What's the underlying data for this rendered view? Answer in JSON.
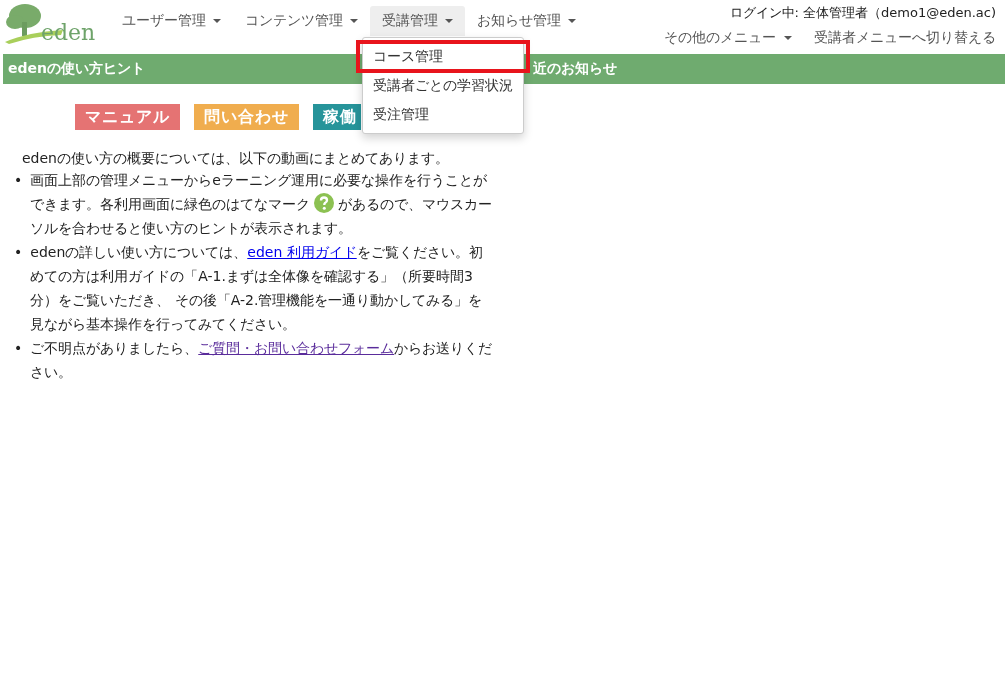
{
  "logo": {
    "text": "eden"
  },
  "nav": [
    {
      "label": "ユーザー管理",
      "selected": false
    },
    {
      "label": "コンテンツ管理",
      "selected": false
    },
    {
      "label": "受講管理",
      "selected": true
    },
    {
      "label": "お知らせ管理",
      "selected": false
    }
  ],
  "dropdown": [
    {
      "label": "コース管理",
      "highlighted": true
    },
    {
      "label": "受講者ごとの学習状況",
      "highlighted": false
    },
    {
      "label": "受注管理",
      "highlighted": false
    }
  ],
  "login": "ログイン中: 全体管理者（demo1@eden.ac)",
  "other_menu": "その他のメニュー",
  "switch_link": "受講者メニューへ切り替える",
  "hint_panel": {
    "title": "edenの使い方ヒント",
    "buttons": [
      {
        "label": "マニュアル",
        "color": "#e57373"
      },
      {
        "label": "問い合わせ",
        "color": "#f0ad4e"
      },
      {
        "label": "稼働",
        "color": "#26949a"
      }
    ],
    "intro": "edenの使い方の概要については、以下の動画にまとめてあります。",
    "bullets": [
      {
        "marker": "•",
        "segments": [
          {
            "kind": "text",
            "text": "画面上部の管理メニューからeラーニング運用に必要な操作を行うことができます。各利用画面に緑色のはてなマーク"
          },
          {
            "kind": "help"
          },
          {
            "kind": "text",
            "text": "があるので、マウスカーソルを合わせると使い方のヒントが表示されます。"
          }
        ]
      },
      {
        "marker": "•",
        "segments": [
          {
            "kind": "text",
            "text": "edenの詳しい使い方については、"
          },
          {
            "kind": "link",
            "text": "eden 利用ガイド",
            "visited": false
          },
          {
            "kind": "text",
            "text": "をご覧ください。初めての方は利用ガイドの「A-1.まずは全体像を確認する」（所要時間3分）をご覧いただき、 その後「A-2.管理機能を一通り動かしてみる」を見ながら基本操作を行ってみてください。"
          }
        ]
      },
      {
        "marker": "•",
        "segments": [
          {
            "kind": "text",
            "text": "ご不明点がありましたら、"
          },
          {
            "kind": "link",
            "text": "ご質問・お問い合わせフォーム",
            "visited": true
          },
          {
            "kind": "text",
            "text": "からお送りください。"
          }
        ]
      }
    ]
  },
  "news_panel": {
    "title": "近のお知らせ"
  }
}
